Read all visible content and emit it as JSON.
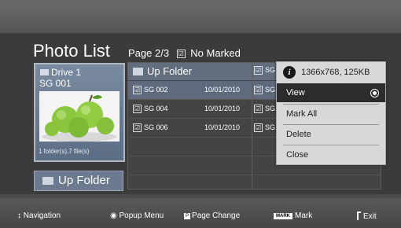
{
  "header": {
    "title": "Photo List",
    "page": "Page 2/3",
    "marked": "No Marked",
    "check_glyph": "☑"
  },
  "preview": {
    "drive": "Drive 1",
    "name": "SG 001",
    "file_info": "1 folder(s),7 file(s)"
  },
  "up_folder_button": "Up Folder",
  "list": {
    "header_label": "Up Folder",
    "header_col2": "SG",
    "rows": [
      {
        "name": "SG 002",
        "date": "10/01/2010",
        "col2": "SG",
        "highlight": true
      },
      {
        "name": "SG 004",
        "date": "10/01/2010",
        "col2": "SG",
        "highlight": false
      },
      {
        "name": "SG 006",
        "date": "10/01/2010",
        "col2": "SG",
        "highlight": false
      }
    ]
  },
  "popup": {
    "info_icon": "i",
    "info": "1366x768, 125KB",
    "items": [
      "View",
      "Mark All",
      "Delete",
      "Close"
    ],
    "selected": "View"
  },
  "footer": {
    "nav_icon": "↕",
    "nav_label": "Navigation",
    "popup_icon": "◉",
    "popup_label": "Popup Menu",
    "page_chip": "P",
    "page_label": "Page Change",
    "mark_chip": "MARK",
    "mark_label": "Mark",
    "exit_label": "Exit"
  }
}
